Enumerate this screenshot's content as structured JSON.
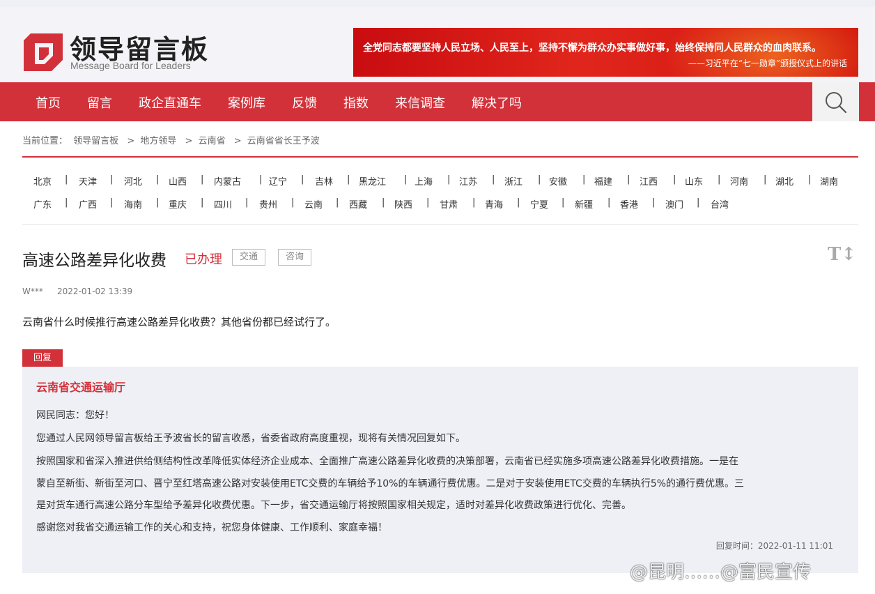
{
  "site": {
    "logo_cn": "领导留言板",
    "logo_en": "Message Board for Leaders",
    "banner_main": "全党同志都要坚持人民立场、人民至上，坚持不懈为群众办实事做好事，始终保持同人民群众的血肉联系。",
    "banner_sub": "——习近平在“七一勋章”颁授仪式上的讲话",
    "brand_color": "#d3313a"
  },
  "nav": {
    "items": [
      "首页",
      "留言",
      "政企直通车",
      "案例库",
      "反馈",
      "指数",
      "来信调查",
      "解决了吗"
    ],
    "search_icon": "search-icon"
  },
  "breadcrumb": {
    "prefix": "当前位置：",
    "items": [
      "领导留言板",
      "地方领导",
      "云南省",
      "云南省省长王予波"
    ],
    "separator": ">"
  },
  "provinces": {
    "row1": [
      "北京",
      "天津",
      "河北",
      "山西",
      "内蒙古",
      "辽宁",
      "吉林",
      "黑龙江",
      "上海",
      "江苏",
      "浙江",
      "安徽",
      "福建",
      "江西",
      "山东",
      "河南",
      "湖北",
      "湖南"
    ],
    "row2": [
      "广东",
      "广西",
      "海南",
      "重庆",
      "四川",
      "贵州",
      "云南",
      "西藏",
      "陕西",
      "甘肃",
      "青海",
      "宁夏",
      "新疆",
      "香港",
      "澳门",
      "台湾"
    ],
    "separator": "|"
  },
  "message": {
    "title": "高速公路差异化收费",
    "status": "已办理",
    "tags": [
      "交通",
      "咨询"
    ],
    "author": "W***",
    "date": "2022-01-02 13:39",
    "content": "云南省什么时候推行高速公路差异化收费？其他省份都已经试行了。",
    "font_toggle_icon": "T↕"
  },
  "reply": {
    "tab_label": "回复",
    "org": "云南省交通运输厅",
    "lines": [
      "网民同志：您好！",
      "您通过人民网领导留言板给王予波省长的留言收悉，省委省政府高度重视，现将有关情况回复如下。",
      "按照国家和省深入推进供给侧结构性改革降低实体经济企业成本、全面推广高速公路差异化收费的决策部署，云南省已经实施多项高速公路差异化收费措施。一是在",
      "蒙自至新街、新街至河口、晋宁至红塔高速公路对安装使用ETC交费的车辆给予10%的车辆通行费优惠。二是对于安装使用ETC交费的车辆执行5%的通行费优惠。三",
      "是对货车通行高速公路分车型给予差异化收费优惠。下一步，省交通运输厅将按照国家相关规定，适时对差异化收费政策进行优化、完善。",
      "感谢您对我省交通运输工作的关心和支持，祝您身体健康、工作顺利、家庭幸福！"
    ],
    "time": "回复时间：2022-01-11 11:01"
  },
  "watermark": "@昆明……@富民宣传"
}
